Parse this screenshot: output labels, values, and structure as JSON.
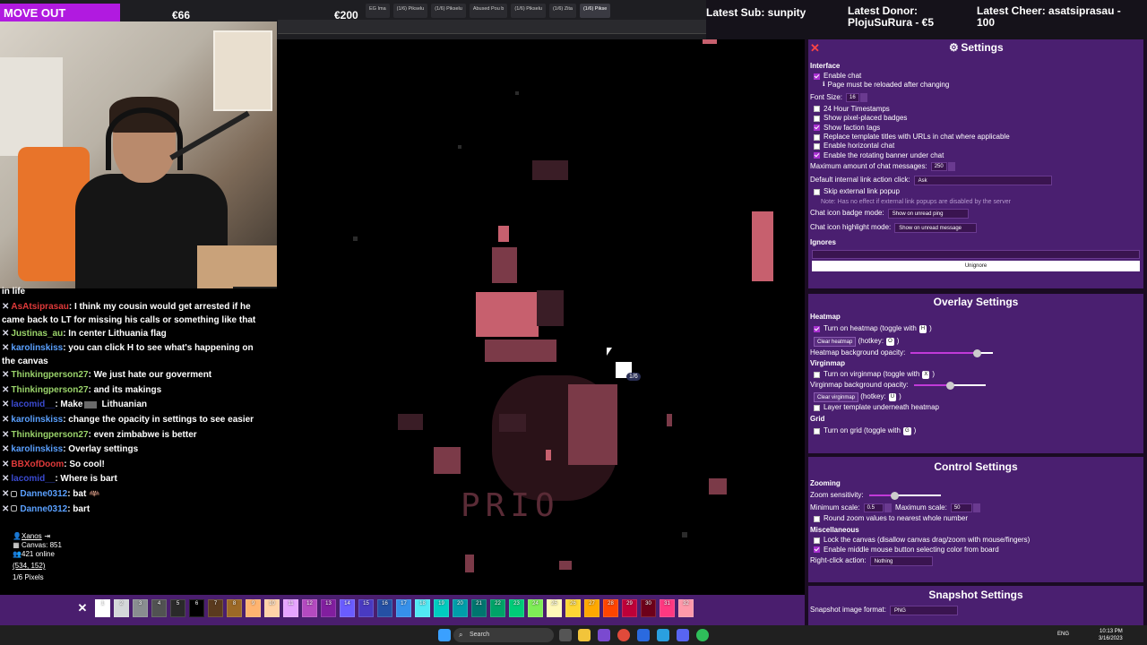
{
  "stream_overlay": {
    "move_out": "MOVE OUT",
    "goal_a": "€66",
    "goal_b": "€200",
    "latest_sub": "Latest Sub: sunpity",
    "latest_donor": "Latest Donor: PlojuSuRura - €5",
    "latest_cheer": "Latest Cheer: asatsiprasau - 100"
  },
  "browser_tabs": [
    {
      "label": "EG Ima",
      "active": false
    },
    {
      "label": "(1/6) Pikselu",
      "active": false
    },
    {
      "label": "(1/6) Pikselu",
      "active": false
    },
    {
      "label": "Abused Pou b",
      "active": false
    },
    {
      "label": "(1/6) Pikselu",
      "active": false
    },
    {
      "label": "(1/6) Zita",
      "active": false
    },
    {
      "label": "(1/6) Pikse",
      "active": true
    }
  ],
  "chat": {
    "partial_line": "in life",
    "messages": [
      {
        "user": "AsAtsiprasau",
        "color": "#e03a3a",
        "text": ": I think my cousin would get arrested if he came back to LT for missing his calls or something like that",
        "wrap": true,
        "badge": false,
        "emote": ""
      },
      {
        "user": "Justinas_au",
        "color": "#9ad36a",
        "text": ": In center Lithuania flag",
        "wrap": false,
        "badge": false,
        "emote": ""
      },
      {
        "user": "karolinskiss",
        "color": "#5aa0ff",
        "text": ": you can click H to see what's happening on the canvas",
        "wrap": true,
        "badge": false,
        "emote": ""
      },
      {
        "user": "Thinkingperson27",
        "color": "#9ad36a",
        "text": ": We just hate our goverment",
        "wrap": false,
        "badge": false,
        "emote": ""
      },
      {
        "user": "Thinkingperson27",
        "color": "#9ad36a",
        "text": ": and its makings",
        "wrap": false,
        "badge": false,
        "emote": ""
      },
      {
        "user": "lacomid__",
        "color": "#3a4ad0",
        "text": ": Make",
        "wrap": false,
        "badge": false,
        "emote": "Lithuanian"
      },
      {
        "user": "karolinskiss",
        "color": "#5aa0ff",
        "text": ": change the opacity in settings to see easier",
        "wrap": false,
        "badge": false,
        "emote": ""
      },
      {
        "user": "Thinkingperson27",
        "color": "#9ad36a",
        "text": ": even zimbabwe is better",
        "wrap": false,
        "badge": false,
        "emote": ""
      },
      {
        "user": "karolinskiss",
        "color": "#5aa0ff",
        "text": ": Overlay settings",
        "wrap": false,
        "badge": false,
        "emote": ""
      },
      {
        "user": "BBXofDoom",
        "color": "#e03a3a",
        "text": ": So cool!",
        "wrap": false,
        "badge": false,
        "emote": ""
      },
      {
        "user": "lacomid__",
        "color": "#3a4ad0",
        "text": ": Where is bart",
        "wrap": false,
        "badge": false,
        "emote": ""
      },
      {
        "user": "Danne0312",
        "color": "#5aa0ff",
        "text": ": bat",
        "wrap": false,
        "badge": true,
        "emote": "🦇"
      },
      {
        "user": "Danne0312",
        "color": "#5aa0ff",
        "text": ": bart",
        "wrap": false,
        "badge": true,
        "emote": ""
      }
    ]
  },
  "stats": {
    "user": "Xanos",
    "canvas": "Canvas: 851",
    "online": "421 online",
    "coords": "(534, 152)",
    "pixels": "1/6 Pixels"
  },
  "board": {
    "text": "PRIO",
    "place_count": "1/6"
  },
  "palette": {
    "colors": [
      "#ffffff",
      "#d4d7d9",
      "#898d90",
      "#515252",
      "#2a2a2a",
      "#000000",
      "#5a3a1e",
      "#9c6926",
      "#ffb470",
      "#ffd3a8",
      "#e6a5ff",
      "#b44ac0",
      "#811e9f",
      "#6a5cff",
      "#493ac1",
      "#2450a4",
      "#3690ea",
      "#51e9f4",
      "#00ccc0",
      "#009eaa",
      "#00756f",
      "#00a368",
      "#00cc78",
      "#7eed56",
      "#fff8b8",
      "#ffd635",
      "#ffa800",
      "#ff4500",
      "#be0039",
      "#6d001a",
      "#ff3881",
      "#ff99aa"
    ],
    "numbers": [
      "1",
      "2",
      "3",
      "4",
      "5",
      "6",
      "7",
      "8",
      "9",
      "10",
      "11",
      "12",
      "13",
      "14",
      "15",
      "16",
      "17",
      "18",
      "19",
      "20",
      "21",
      "22",
      "23",
      "24",
      "25",
      "26",
      "27",
      "28",
      "29",
      "30",
      "31",
      "32",
      "33"
    ]
  },
  "settings": {
    "title": "Settings",
    "interface": {
      "heading": "Interface",
      "enable_chat": "Enable chat",
      "reload_note": "Page must be reloaded after changing",
      "font_size_label": "Font Size:",
      "font_size_value": "16",
      "opt_24h": "24 Hour Timestamps",
      "opt_badges": "Show pixel-placed badges",
      "opt_faction": "Show faction tags",
      "opt_replace": "Replace template titles with URLs in chat where applicable",
      "opt_horizontal": "Enable horizontal chat",
      "opt_banner": "Enable the rotating banner under chat",
      "max_chat_label": "Maximum amount of chat messages:",
      "max_chat_value": "250",
      "link_action_label": "Default internal link action click:",
      "link_action_value": "Ask",
      "skip_popup": "Skip external link popup",
      "skip_note": "Note: Has no effect if external link popups are disabled by the server",
      "badge_mode_label": "Chat icon badge mode:",
      "badge_mode_value": "Show on unread ping",
      "highlight_mode_label": "Chat icon highlight mode:",
      "highlight_mode_value": "Show on unread message",
      "ignores_heading": "Ignores",
      "unignore": "Unignore"
    },
    "overlay": {
      "title": "Overlay Settings",
      "heatmap_heading": "Heatmap",
      "heatmap_toggle": "Turn on heatmap (toggle with",
      "heatmap_key": "H",
      "clear_heatmap": "Clear heatmap",
      "hotkey_label": "(hotkey:",
      "heatmap_hotkey": "O",
      "heatmap_opacity_label": "Heatmap background opacity:",
      "heatmap_opacity": 0.8,
      "virginmap_heading": "Virginmap",
      "virginmap_toggle": "Turn on virginmap (toggle with",
      "virginmap_key": "X",
      "virginmap_opacity_label": "Virginmap background opacity:",
      "virginmap_opacity": 0.5,
      "clear_virginmap": "Clear virginmap",
      "virginmap_hotkey": "U",
      "layer_template": "Layer template underneath heatmap",
      "grid_heading": "Grid",
      "grid_toggle": "Turn on grid (toggle with",
      "grid_key": "G"
    },
    "control": {
      "title": "Control Settings",
      "zooming_heading": "Zooming",
      "zoom_sensitivity_label": "Zoom sensitivity:",
      "zoom_sensitivity": 0.35,
      "min_scale_label": "Minimum scale:",
      "min_scale": "0.5",
      "max_scale_label": "Maximum scale:",
      "max_scale": "50",
      "round_zoom": "Round zoom values to nearest whole number",
      "misc_heading": "Miscellaneous",
      "lock_canvas": "Lock the canvas (disallow canvas drag/zoom with mouse/fingers)",
      "middle_mouse": "Enable middle mouse button selecting color from board",
      "right_click_label": "Right-click action:",
      "right_click_value": "Nothing"
    },
    "snapshot": {
      "title": "Snapshot Settings",
      "format_label": "Snapshot image format:",
      "format_value": "PNG"
    }
  },
  "taskbar": {
    "search": "Search",
    "lang": "ENG",
    "time": "10:13 PM",
    "date": "3/16/2023"
  }
}
